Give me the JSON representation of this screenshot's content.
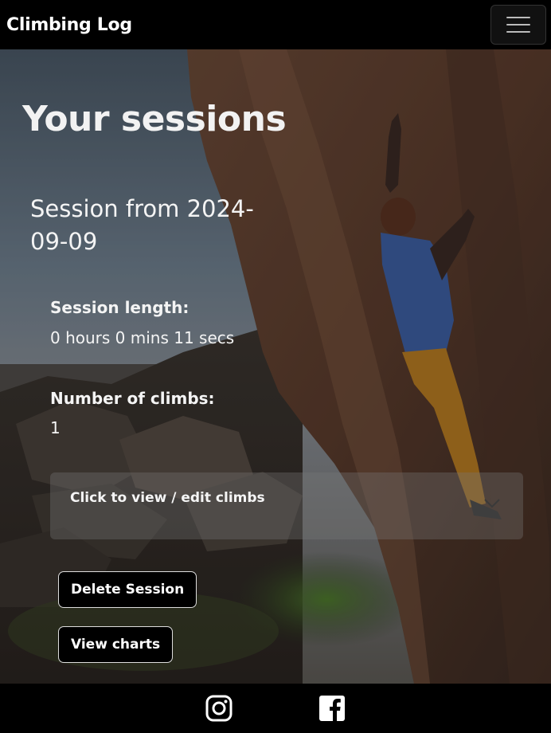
{
  "navbar": {
    "brand": "Climbing Log"
  },
  "page": {
    "title": "Your sessions"
  },
  "session": {
    "title": "Session from 2024-09-09",
    "length_label": "Session length:",
    "length_value": "0 hours 0 mins 11 secs",
    "climbs_label": "Number of climbs:",
    "climbs_value": "1",
    "accordion_label": "Click to view / edit climbs",
    "delete_label": "Delete Session",
    "charts_label": "View charts"
  },
  "footer": {
    "icons": [
      "instagram-icon",
      "facebook-icon"
    ]
  },
  "colors": {
    "navbar": "#000000",
    "button_bg": "#000000",
    "button_border": "#dddddd"
  }
}
